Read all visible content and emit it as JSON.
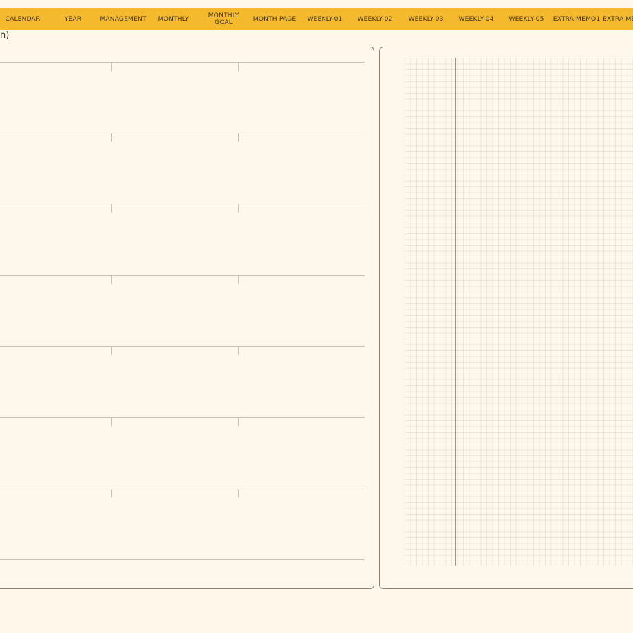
{
  "nav": {
    "tabs": [
      {
        "label": "CALENDAR"
      },
      {
        "label": "YEAR"
      },
      {
        "label": "MANAGEMENT"
      },
      {
        "label": "MONTHLY"
      },
      {
        "label": "MONTHLY GOAL"
      },
      {
        "label": "MONTH PAGE"
      },
      {
        "label": "WEEKLY-01"
      },
      {
        "label": "WEEKLY-02"
      },
      {
        "label": "WEEKLY-03"
      },
      {
        "label": "WEEKLY-04"
      },
      {
        "label": "WEEKLY-05"
      },
      {
        "label": "EXTRA MEMO1"
      },
      {
        "label": "EXTRA ME"
      }
    ]
  },
  "header_fragment": "n)",
  "colors": {
    "nav_background": "#f5b92e",
    "page_background": "#fef7ea",
    "text": "#3b3422",
    "panel_border": "#8a8170"
  }
}
